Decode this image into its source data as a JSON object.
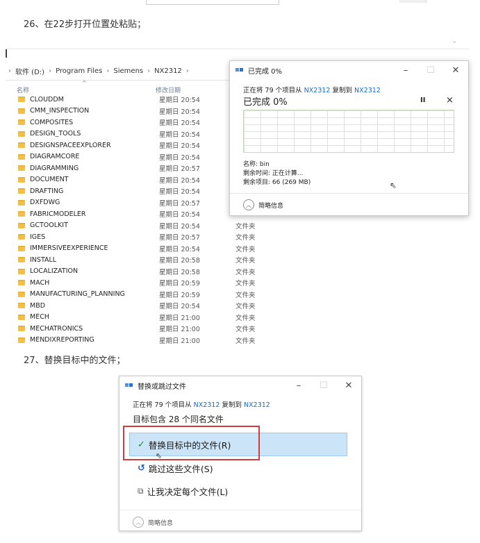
{
  "step26": "26、在22步打开位置处粘贴；",
  "step27": "27、替换目标中的文件；",
  "explorer": {
    "breadcrumb": [
      "软件 (D:)",
      "Program Files",
      "Siemens",
      "NX2312"
    ],
    "col_name": "名称",
    "col_date": "修改日期",
    "rows": [
      {
        "name": "CLOUDDM",
        "date": "星期日 20:54",
        "type": ""
      },
      {
        "name": "CMM_INSPECTION",
        "date": "星期日 20:54",
        "type": ""
      },
      {
        "name": "COMPOSITES",
        "date": "星期日 20:54",
        "type": ""
      },
      {
        "name": "DESIGN_TOOLS",
        "date": "星期日 20:54",
        "type": ""
      },
      {
        "name": "DESIGNSPACEEXPLORER",
        "date": "星期日 20:54",
        "type": ""
      },
      {
        "name": "DIAGRAMCORE",
        "date": "星期日 20:54",
        "type": ""
      },
      {
        "name": "DIAGRAMMING",
        "date": "星期日 20:57",
        "type": ""
      },
      {
        "name": "DOCUMENT",
        "date": "星期日 20:54",
        "type": ""
      },
      {
        "name": "DRAFTING",
        "date": "星期日 20:54",
        "type": ""
      },
      {
        "name": "DXFDWG",
        "date": "星期日 20:57",
        "type": ""
      },
      {
        "name": "FABRICMODELER",
        "date": "星期日 20:54",
        "type": ""
      },
      {
        "name": "GCTOOLKIT",
        "date": "星期日 20:54",
        "type": "文件夹"
      },
      {
        "name": "IGES",
        "date": "星期日 20:57",
        "type": "文件夹"
      },
      {
        "name": "IMMERSIVEEXPERIENCE",
        "date": "星期日 20:54",
        "type": "文件夹"
      },
      {
        "name": "INSTALL",
        "date": "星期日 20:58",
        "type": "文件夹"
      },
      {
        "name": "LOCALIZATION",
        "date": "星期日 20:58",
        "type": "文件夹"
      },
      {
        "name": "MACH",
        "date": "星期日 20:59",
        "type": "文件夹"
      },
      {
        "name": "MANUFACTURING_PLANNING",
        "date": "星期日 20:59",
        "type": "文件夹"
      },
      {
        "name": "MBD",
        "date": "星期日 20:54",
        "type": "文件夹"
      },
      {
        "name": "MECH",
        "date": "星期日 21:00",
        "type": "文件夹"
      },
      {
        "name": "MECHATRONICS",
        "date": "星期日 21:00",
        "type": "文件夹"
      },
      {
        "name": "MENDIXREPORTING",
        "date": "星期日 21:00",
        "type": "文件夹"
      }
    ]
  },
  "copy_dialog": {
    "title": "已完成 0%",
    "line_pre": "正在将 79 个项目从",
    "src": "NX2312",
    "line_mid": "复制到",
    "dst": "NX2312",
    "progress_text": "已完成 0%",
    "progress_value": 0,
    "pause": "II",
    "close": "×",
    "name_label": "名称: bin",
    "time_label": "剩余时间: 正在计算...",
    "items_label": "剩余项目: 66 (269 MB)",
    "collapse": "简略信息"
  },
  "replace_dialog": {
    "title": "替换或跳过文件",
    "line_pre": "正在将 79 个项目从",
    "src": "NX2312",
    "line_mid": "复制到",
    "dst": "NX2312",
    "subtitle": "目标包含 28 个同名文件",
    "opt_replace": "替换目标中的文件(R)",
    "opt_skip": "跳过这些文件(S)",
    "opt_decide": "让我决定每个文件(L)",
    "collapse": "简略信息"
  }
}
